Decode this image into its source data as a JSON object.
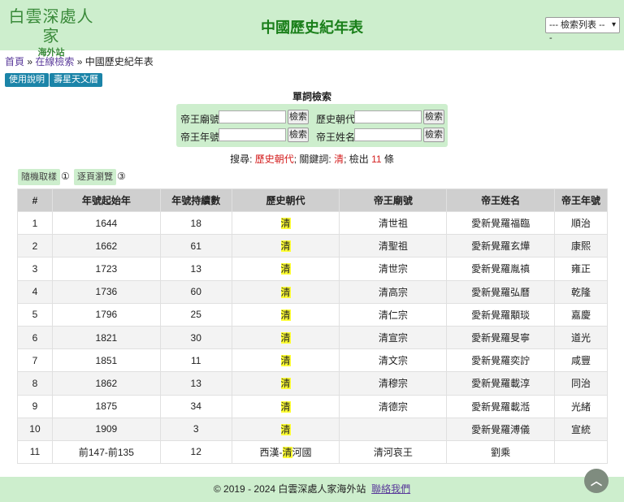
{
  "logo": {
    "line1": "白雲深處人家",
    "line2": "海外站"
  },
  "page_title": "中國歷史紀年表",
  "search_select": {
    "selected": "--- 檢索列表 ---",
    "icon": "chevron-down-icon"
  },
  "breadcrumb": {
    "home": "首頁",
    "sep1": " » ",
    "online": "在線檢索",
    "sep2": " » ",
    "current": "中國歷史紀年表"
  },
  "buttons": {
    "usage": "使用說明",
    "calendar": "壽星天文曆"
  },
  "search": {
    "heading": "單詞檢索",
    "fields": [
      {
        "label": "帝王廟號",
        "button": "檢索"
      },
      {
        "label": "歷史朝代",
        "button": "檢索"
      },
      {
        "label": "帝王年號",
        "button": "檢索"
      },
      {
        "label": "帝王姓名",
        "button": "檢索"
      }
    ]
  },
  "result": {
    "prefix": "搜尋: ",
    "field": "歷史朝代",
    "mid": "; 關鍵詞: ",
    "keyword": "清",
    "count_prefix": "; 檢出 ",
    "count": "11",
    "suffix": " 條"
  },
  "tools": {
    "random": "隨機取樣",
    "random_n": "①",
    "paging": "逐頁瀏覽",
    "paging_n": "③"
  },
  "table": {
    "headers": [
      "#",
      "年號起始年",
      "年號持續數",
      "歷史朝代",
      "帝王廟號",
      "帝王姓名",
      "帝王年號"
    ],
    "rows": [
      [
        "1",
        "1644",
        "18",
        "清",
        "清世祖",
        "愛新覺羅福臨",
        "順治"
      ],
      [
        "2",
        "1662",
        "61",
        "清",
        "清聖祖",
        "愛新覺羅玄燁",
        "康熙"
      ],
      [
        "3",
        "1723",
        "13",
        "清",
        "清世宗",
        "愛新覺羅胤禛",
        "雍正"
      ],
      [
        "4",
        "1736",
        "60",
        "清",
        "清高宗",
        "愛新覺羅弘曆",
        "乾隆"
      ],
      [
        "5",
        "1796",
        "25",
        "清",
        "清仁宗",
        "愛新覺羅顒琰",
        "嘉慶"
      ],
      [
        "6",
        "1821",
        "30",
        "清",
        "清宣宗",
        "愛新覺羅旻寧",
        "道光"
      ],
      [
        "7",
        "1851",
        "11",
        "清",
        "清文宗",
        "愛新覺羅奕詝",
        "咸豐"
      ],
      [
        "8",
        "1862",
        "13",
        "清",
        "清穆宗",
        "愛新覺羅載淳",
        "同治"
      ],
      [
        "9",
        "1875",
        "34",
        "清",
        "清德宗",
        "愛新覺羅載湉",
        "光緒"
      ],
      [
        "10",
        "1909",
        "3",
        "清",
        "",
        "愛新覺羅溥儀",
        "宣統"
      ],
      [
        "11",
        "前147-前135",
        "12",
        "西漢-清河國",
        "清河哀王",
        "劉乘",
        ""
      ]
    ],
    "highlight": "清"
  },
  "footer": {
    "copyright": "© 2019 - 2024 白雲深處人家海外站",
    "contact": "聯絡我們"
  },
  "to_top": {
    "icon": "chevron-up-icon",
    "glyph": "︿"
  }
}
